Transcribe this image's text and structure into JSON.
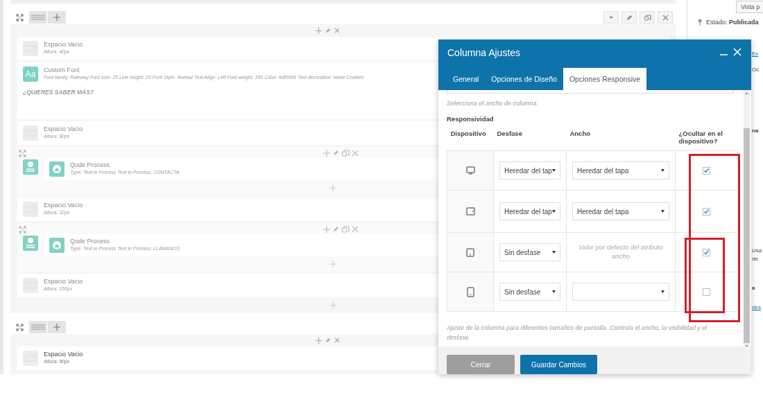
{
  "builder": {
    "sections": [
      {
        "row_tools": true,
        "items": [
          {
            "kind": "spacer",
            "title": "Espacio Vacio",
            "detail": "Altura: 40px",
            "dimmed": true
          },
          {
            "kind": "font",
            "icon_text": "Aa",
            "title": "Custom Font",
            "detail": "Font family: Raleway  Font size: 25  Line height: 20  Font Style: Normal  Text Align: Left  Font weight: 300  Color: #df0066  Text decoration: None  Content:",
            "content": "¿QUIERES SABER MÁS?",
            "dimmed": true
          },
          {
            "kind": "spacer",
            "title": "Espacio Vacio",
            "detail": "Altura: 90px",
            "dimmed": true
          },
          {
            "kind": "inner_row",
            "title": "Qode Process",
            "detail": "Type: Text in Process  Text in Process: CONTACTA",
            "dimmed": true
          },
          {
            "kind": "spacer",
            "title": "Espacio Vacio",
            "detail": "Altura: 32px",
            "dimmed": true
          },
          {
            "kind": "inner_row",
            "title": "Qode Process",
            "detail": "Type: Text in Process  Text in Process: LLÁMANOS",
            "dimmed": true
          },
          {
            "kind": "spacer",
            "title": "Espacio Vacio",
            "detail": "Altura: 150px",
            "dimmed": true
          }
        ]
      },
      {
        "items": [
          {
            "kind": "spacer",
            "title": "Espacio Vacio",
            "detail": "Altura: 90px",
            "dimmed": false
          }
        ]
      }
    ]
  },
  "sidebar": {
    "preview_button": "Vista p",
    "status": "Estado: **Publicada**",
    "fragments": [
      {
        "kind": "link",
        "text": "Ex"
      },
      {
        "kind": "text",
        "text": "Oc"
      },
      {
        "kind": "heading",
        "text": "na"
      },
      {
        "kind": "text",
        "text": "Usa"
      },
      {
        "kind": "text",
        "text": "de"
      },
      {
        "kind": "heading",
        "text": "a"
      },
      {
        "kind": "link",
        "text": "des"
      }
    ]
  },
  "modal": {
    "title": "Columna Ajustes",
    "tabs": [
      {
        "label": "General",
        "selected": false
      },
      {
        "label": "Opciones de Diseño",
        "selected": false
      },
      {
        "label": "Opciones Responsive",
        "selected": true
      }
    ],
    "hint": "Selecciona el ancho de columna.",
    "section_label": "Responsividad",
    "columns": [
      "Dispositivo",
      "Desfase",
      "Ancho",
      "¿Ocultar en el dispositivo?"
    ],
    "rows": [
      {
        "kind": "desktop",
        "offset": "Heredar del tap",
        "width": {
          "kind": "select",
          "value": "Heredar del tapa"
        },
        "hidden": true
      },
      {
        "kind": "tablet-landscape",
        "offset": "Heredar del tap",
        "width": {
          "kind": "select",
          "value": "Heredar del tapa"
        },
        "hidden": true
      },
      {
        "kind": "tablet-portrait",
        "offset": "Sin desfase",
        "width": {
          "kind": "note",
          "value": "Valor por defecto del atributo ancho"
        },
        "hidden": true
      },
      {
        "kind": "phone",
        "offset": "Sin desfase",
        "width": {
          "kind": "select"
        },
        "hidden": false
      }
    ],
    "footnote": "Ajuste de la columna para diferentes tamaños de pantalla. Controla el ancho, la visibilidad y el desfase.",
    "buttons": [
      {
        "kind": "secondary",
        "label": "Cerrar"
      },
      {
        "kind": "primary",
        "label": "Guardar Cambios"
      }
    ]
  }
}
